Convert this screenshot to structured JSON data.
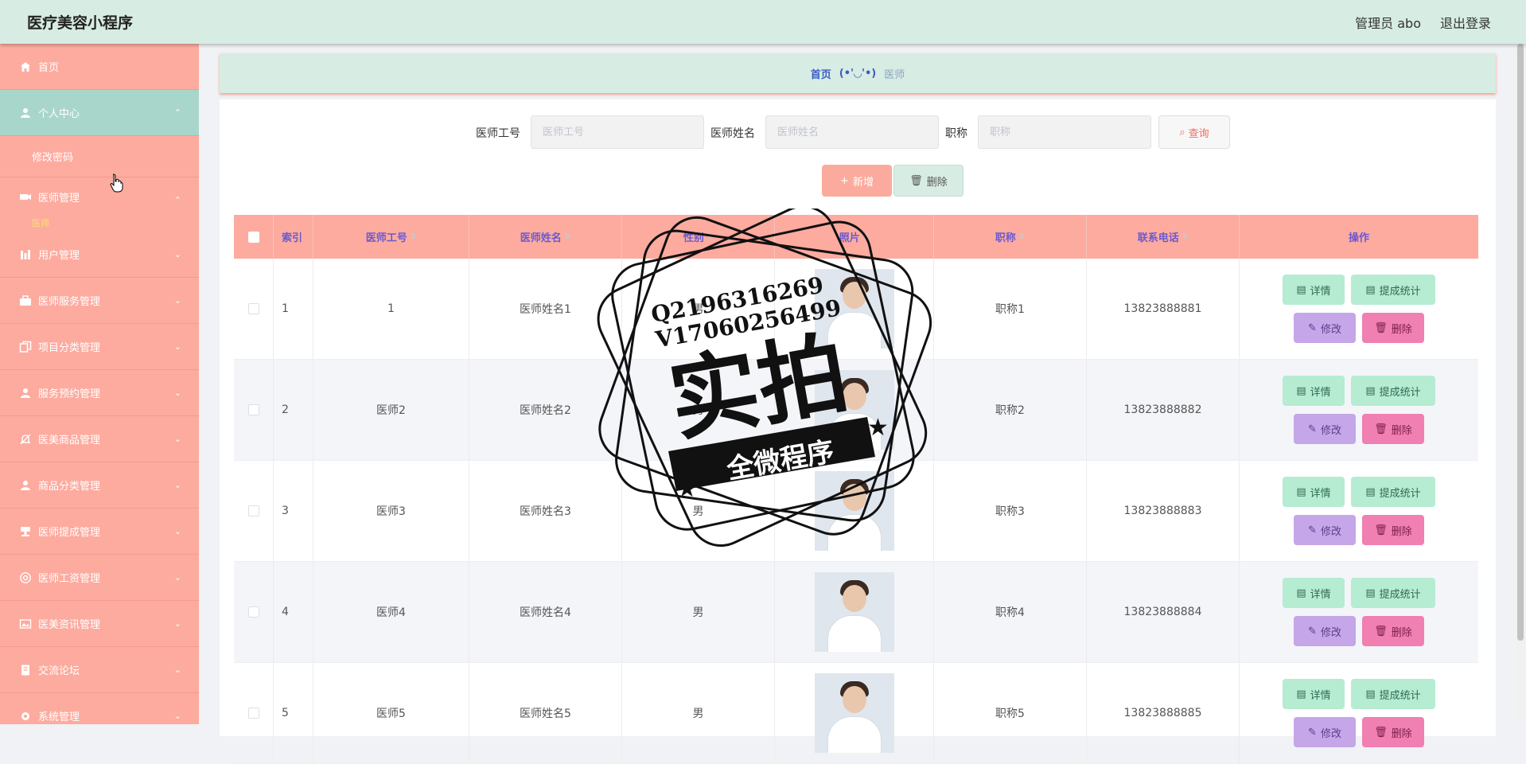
{
  "app": {
    "title": "医疗美容小程序",
    "admin": "管理员 abo",
    "logout": "退出登录"
  },
  "sidebar": {
    "items": [
      {
        "label": "首页",
        "icon": "home-icon"
      },
      {
        "label": "个人中心",
        "icon": "user-icon"
      },
      {
        "label": "医师管理",
        "icon": "camera-icon"
      },
      {
        "label": "用户管理",
        "icon": "chart-icon"
      },
      {
        "label": "医师服务管理",
        "icon": "briefcase-icon"
      },
      {
        "label": "项目分类管理",
        "icon": "copy-icon"
      },
      {
        "label": "服务预约管理",
        "icon": "user-icon"
      },
      {
        "label": "医美商品管理",
        "icon": "bell-off-icon"
      },
      {
        "label": "商品分类管理",
        "icon": "user-icon"
      },
      {
        "label": "医师提成管理",
        "icon": "stamp-icon"
      },
      {
        "label": "医师工资管理",
        "icon": "circle-icon"
      },
      {
        "label": "医美资讯管理",
        "icon": "picture-icon"
      },
      {
        "label": "交流论坛",
        "icon": "notebook-icon"
      },
      {
        "label": "系统管理",
        "icon": "settings-icon"
      }
    ],
    "sub_change_password": "修改密码",
    "sub_doctor": "医师"
  },
  "breadcrumb": {
    "home": "首页",
    "emoji": "(•'◡'•)",
    "current": "医师"
  },
  "search": {
    "id_label": "医师工号",
    "id_placeholder": "医师工号",
    "name_label": "医师姓名",
    "name_placeholder": "医师姓名",
    "title_label": "职称",
    "title_placeholder": "职称",
    "query": "查询"
  },
  "actions": {
    "add": "新增",
    "delete": "删除"
  },
  "table": {
    "headers": {
      "index": "索引",
      "id": "医师工号",
      "name": "医师姓名",
      "gender": "性别",
      "photo": "照片",
      "title": "职称",
      "phone": "联系电话",
      "ops": "操作"
    },
    "rows": [
      {
        "index": "1",
        "id": "1",
        "name": "医师姓名1",
        "gender": "男",
        "title": "职称1",
        "phone": "13823888881"
      },
      {
        "index": "2",
        "id": "医师2",
        "name": "医师姓名2",
        "gender": "男",
        "title": "职称2",
        "phone": "13823888882"
      },
      {
        "index": "3",
        "id": "医师3",
        "name": "医师姓名3",
        "gender": "男",
        "title": "职称3",
        "phone": "13823888883"
      },
      {
        "index": "4",
        "id": "医师4",
        "name": "医师姓名4",
        "gender": "男",
        "title": "职称4",
        "phone": "13823888884"
      },
      {
        "index": "5",
        "id": "医师5",
        "name": "医师姓名5",
        "gender": "男",
        "title": "职称5",
        "phone": "13823888885"
      }
    ],
    "ops": {
      "detail": "详情",
      "stat": "提成统计",
      "edit": "修改",
      "remove": "删除"
    }
  },
  "watermark": {
    "line1": "Q2196316269",
    "line2": "V17060256499",
    "big": "实拍",
    "banner": "全微程序"
  },
  "colors": {
    "sidebar": "#fdab9f",
    "topbar": "#d7ece2",
    "accent": "#6a5ad0"
  }
}
